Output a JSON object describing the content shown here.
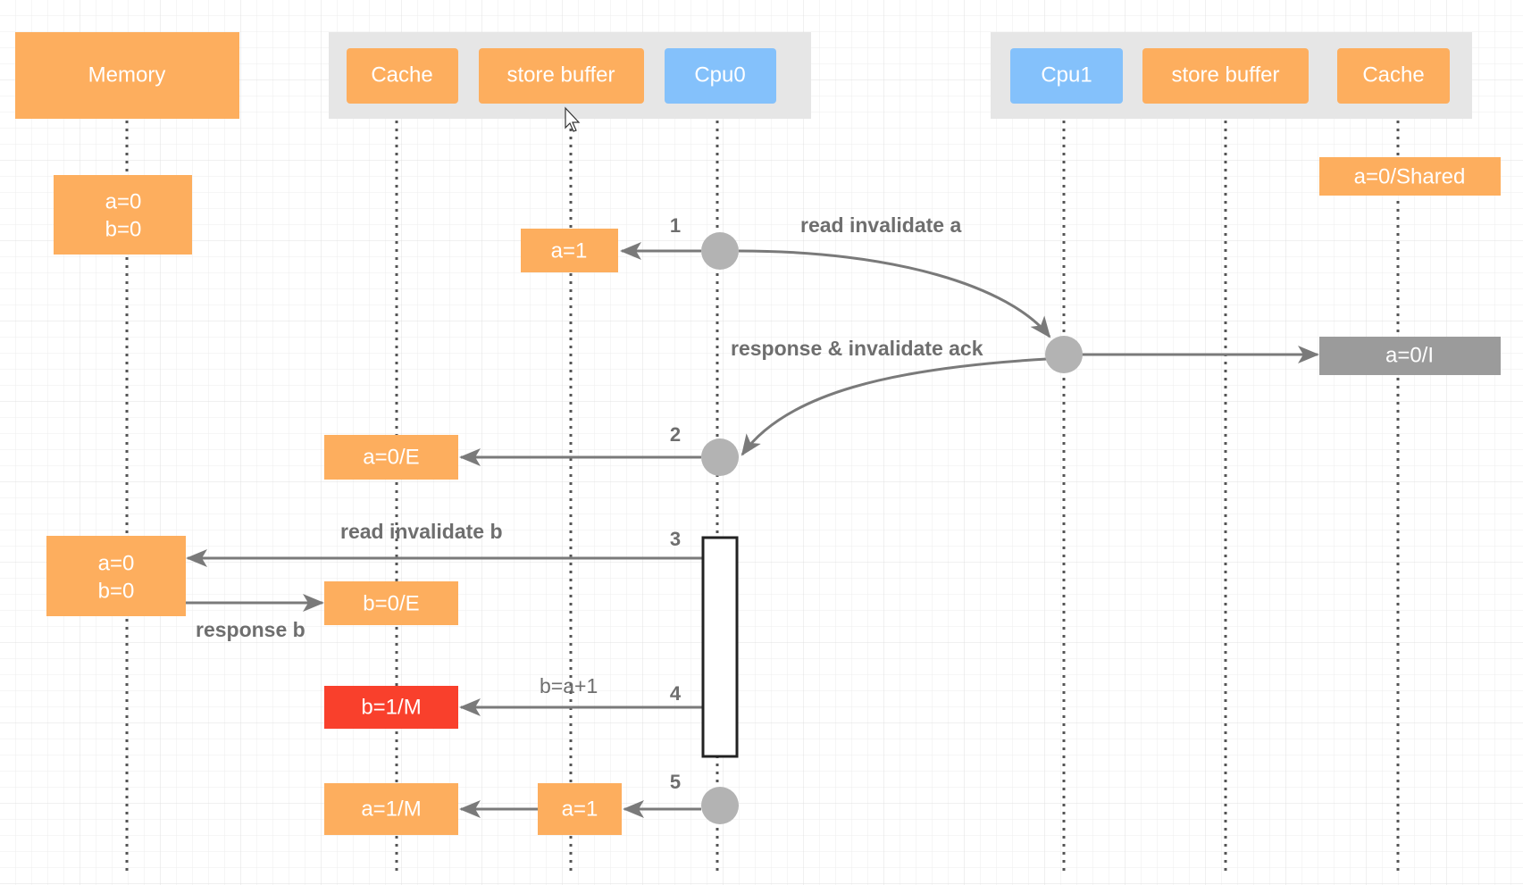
{
  "colors": {
    "orange": "#fdae5e",
    "blue": "#84c1fb",
    "red": "#f9402c",
    "invalid_gray": "#9b9b9b",
    "group_bg": "#e6e6e6",
    "arrow": "#7a7a7a"
  },
  "participants": {
    "memory": "Memory",
    "cpu0_group": {
      "cache": "Cache",
      "store_buffer": "store buffer",
      "cpu": "Cpu0"
    },
    "cpu1_group": {
      "cpu": "Cpu1",
      "store_buffer": "store buffer",
      "cache": "Cache"
    }
  },
  "states": {
    "memory_initial": [
      "a=0",
      "b=0"
    ],
    "cpu1_cache_initial": "a=0/Shared",
    "cpu0_sb_step1": "a=1",
    "cpu1_cache_invalid": "a=0/I",
    "cpu0_cache_step2": "a=0/E",
    "memory_step3": [
      "a=0",
      "b=0"
    ],
    "cpu0_cache_b": "b=0/E",
    "cpu0_cache_b_modified": "b=1/M",
    "cpu0_sb_step5": "a=1",
    "cpu0_cache_step5": "a=1/M"
  },
  "messages": {
    "read_invalidate_a": "read invalidate a",
    "response_invalidate_ack": "response & invalidate ack",
    "read_invalidate_b": "read invalidate b",
    "response_b": "response b",
    "b_assign": "b=a+1"
  },
  "steps": [
    "1",
    "2",
    "3",
    "4",
    "5"
  ]
}
